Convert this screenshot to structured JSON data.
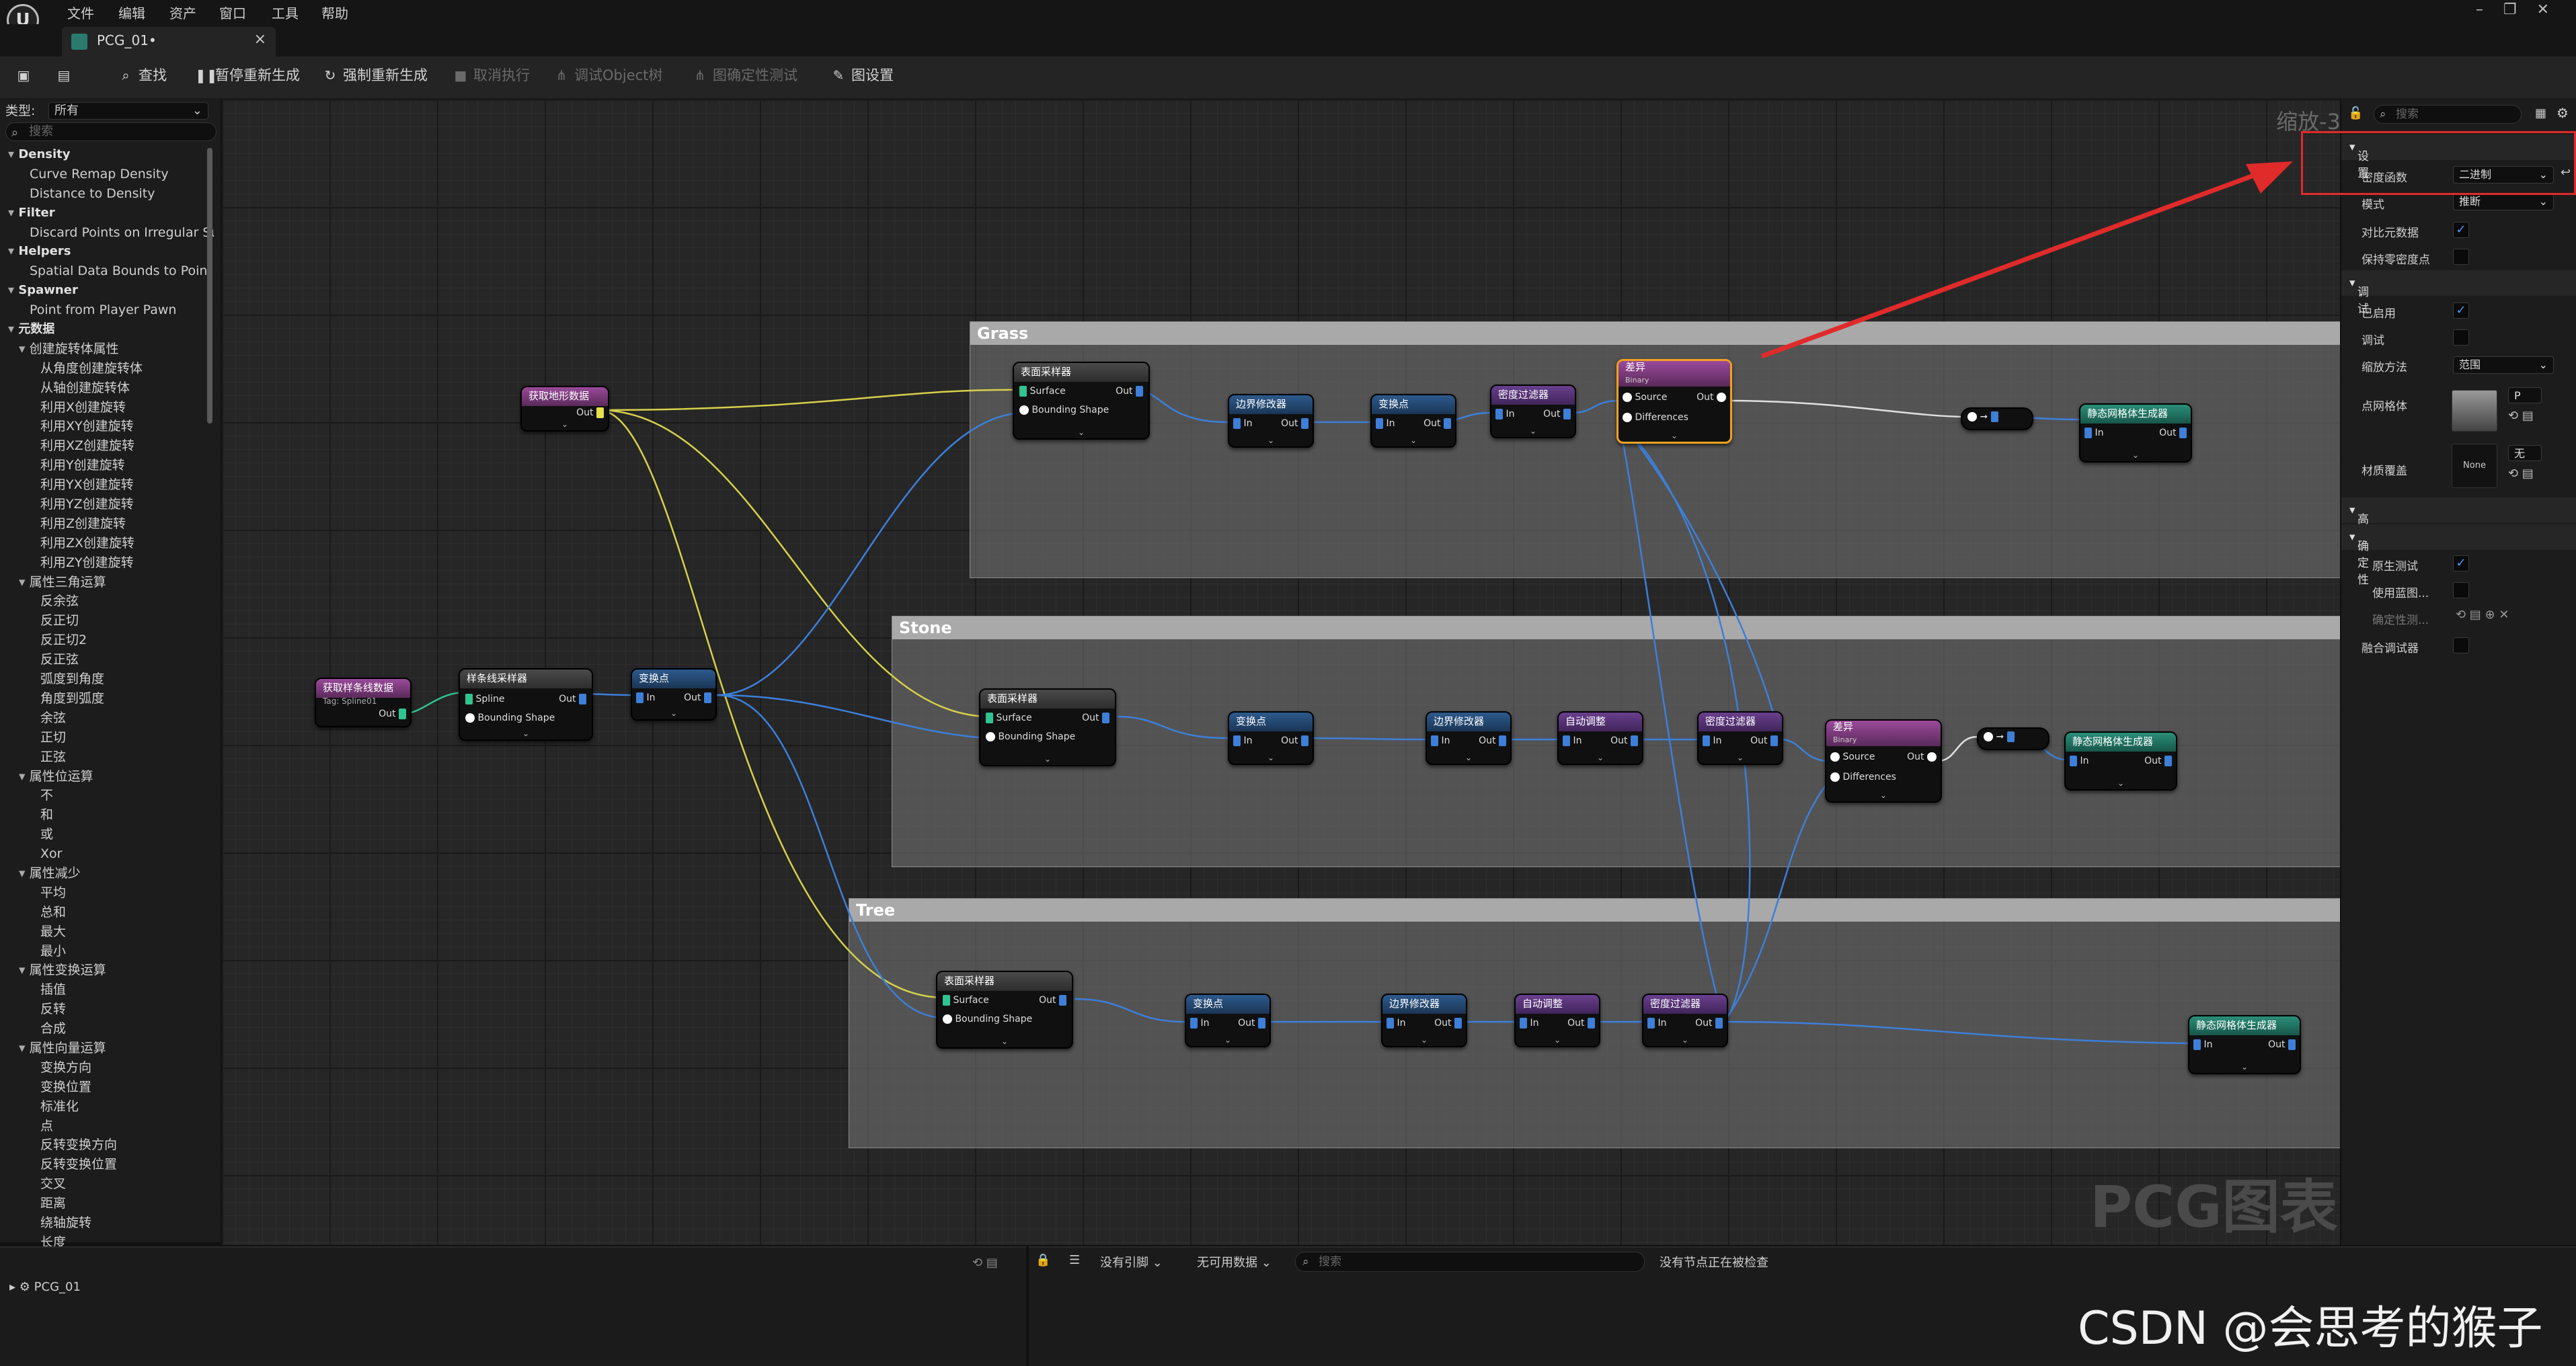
{
  "menu": {
    "items": [
      "文件",
      "编辑",
      "资产",
      "窗口",
      "工具",
      "帮助"
    ]
  },
  "tab": {
    "title": "PCG_01•",
    "close": "×"
  },
  "toolbar": {
    "find": "查找",
    "pause": "暂停重新生成",
    "force": "强制重新生成",
    "cancel": "取消执行",
    "debug_obj": "调试Object树",
    "determinism": "图确定性测试",
    "graph_settings": "图设置"
  },
  "palette": {
    "type_label": "类型:",
    "type_value": "所有",
    "search_placeholder": "搜索",
    "items": [
      {
        "t": "Density",
        "k": "cat"
      },
      {
        "t": "Curve Remap Density",
        "k": "i1"
      },
      {
        "t": "Distance to Density",
        "k": "i1"
      },
      {
        "t": "Filter",
        "k": "cat"
      },
      {
        "t": "Discard Points on Irregular Su",
        "k": "i1"
      },
      {
        "t": "Helpers",
        "k": "cat"
      },
      {
        "t": "Spatial Data Bounds to Point",
        "k": "i1"
      },
      {
        "t": "Spawner",
        "k": "cat"
      },
      {
        "t": "Point from Player Pawn",
        "k": "i1"
      },
      {
        "t": "元数据",
        "k": "cat"
      },
      {
        "t": "创建旋转体属性",
        "k": "sub"
      },
      {
        "t": "从角度创建旋转体",
        "k": "i2"
      },
      {
        "t": "从轴创建旋转体",
        "k": "i2"
      },
      {
        "t": "利用X创建旋转",
        "k": "i2"
      },
      {
        "t": "利用XY创建旋转",
        "k": "i2"
      },
      {
        "t": "利用XZ创建旋转",
        "k": "i2"
      },
      {
        "t": "利用Y创建旋转",
        "k": "i2"
      },
      {
        "t": "利用YX创建旋转",
        "k": "i2"
      },
      {
        "t": "利用YZ创建旋转",
        "k": "i2"
      },
      {
        "t": "利用Z创建旋转",
        "k": "i2"
      },
      {
        "t": "利用ZX创建旋转",
        "k": "i2"
      },
      {
        "t": "利用ZY创建旋转",
        "k": "i2"
      },
      {
        "t": "属性三角运算",
        "k": "sub"
      },
      {
        "t": "反余弦",
        "k": "i2"
      },
      {
        "t": "反正切",
        "k": "i2"
      },
      {
        "t": "反正切2",
        "k": "i2"
      },
      {
        "t": "反正弦",
        "k": "i2"
      },
      {
        "t": "弧度到角度",
        "k": "i2"
      },
      {
        "t": "角度到弧度",
        "k": "i2"
      },
      {
        "t": "余弦",
        "k": "i2"
      },
      {
        "t": "正切",
        "k": "i2"
      },
      {
        "t": "正弦",
        "k": "i2"
      },
      {
        "t": "属性位运算",
        "k": "sub"
      },
      {
        "t": "不",
        "k": "i2"
      },
      {
        "t": "和",
        "k": "i2"
      },
      {
        "t": "或",
        "k": "i2"
      },
      {
        "t": "Xor",
        "k": "i2"
      },
      {
        "t": "属性减少",
        "k": "sub"
      },
      {
        "t": "平均",
        "k": "i2"
      },
      {
        "t": "总和",
        "k": "i2"
      },
      {
        "t": "最大",
        "k": "i2"
      },
      {
        "t": "最小",
        "k": "i2"
      },
      {
        "t": "属性变换运算",
        "k": "sub"
      },
      {
        "t": "插值",
        "k": "i2"
      },
      {
        "t": "反转",
        "k": "i2"
      },
      {
        "t": "合成",
        "k": "i2"
      },
      {
        "t": "属性向量运算",
        "k": "sub"
      },
      {
        "t": "变换方向",
        "k": "i2"
      },
      {
        "t": "变换位置",
        "k": "i2"
      },
      {
        "t": "标准化",
        "k": "i2"
      },
      {
        "t": "点",
        "k": "i2"
      },
      {
        "t": "反转变换方向",
        "k": "i2"
      },
      {
        "t": "反转变换位置",
        "k": "i2"
      },
      {
        "t": "交叉",
        "k": "i2"
      },
      {
        "t": "距离",
        "k": "i2"
      },
      {
        "t": "绕轴旋转",
        "k": "i2"
      },
      {
        "t": "长度",
        "k": "i2"
      }
    ]
  },
  "graph": {
    "zoom": "缩放-3",
    "watermark": "PCG图表",
    "comments": {
      "grass": "Grass",
      "stone": "Stone",
      "tree": "Tree"
    },
    "nodes": {
      "get_landscape": "获取地形数据",
      "get_spline": "获取样条线数据",
      "spline_tag": "Tag: Spline01",
      "spline_sampler": "样条线采样器",
      "transform": "变换点",
      "surface_sampler": "表面采样器",
      "bounds_modifier": "边界修改器",
      "density_filter": "密度过滤器",
      "difference": "差异",
      "binary": "Binary",
      "static_mesh_spawner": "静态网格体生成器",
      "self_pruning": "自动调整"
    },
    "pins": {
      "out": "Out",
      "in": "In",
      "surface": "Surface",
      "bounding_shape": "Bounding Shape",
      "spline": "Spline",
      "source": "Source",
      "differences": "Differences"
    }
  },
  "details": {
    "search_placeholder": "搜索",
    "sections": {
      "settings": "设置",
      "debug": "调试",
      "advanced": "高级",
      "determinism": "确定性"
    },
    "rows": {
      "density_func": {
        "label": "密度函数",
        "value": "二进制"
      },
      "mode": {
        "label": "模式",
        "value": "推断"
      },
      "diff_metadata": {
        "label": "对比元数据"
      },
      "keep_zero": {
        "label": "保持零密度点"
      },
      "enabled": {
        "label": "已启用"
      },
      "debug": {
        "label": "调试"
      },
      "scale_method": {
        "label": "缩放方法",
        "value": "范围"
      },
      "point_mesh": {
        "label": "点网格体",
        "value": "P"
      },
      "material_override": {
        "label": "材质覆盖",
        "value": "None",
        "value2": "无"
      },
      "native_test": {
        "label": "原生测试"
      },
      "use_blueprint": {
        "label": "使用蓝图..."
      },
      "determinism_settings": {
        "label": "确定性测..."
      },
      "fuse_debugger": {
        "label": "融合调试器"
      }
    }
  },
  "bottom": {
    "tree_root": "PCG_01",
    "no_ref": "没有引脚",
    "no_data": "无可用数据",
    "search_placeholder": "搜索",
    "status": "没有节点正在被检查"
  },
  "watermark_csdn": "CSDN @会思考的猴子"
}
